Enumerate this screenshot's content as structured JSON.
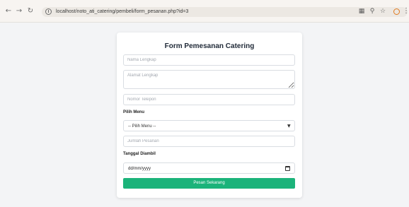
{
  "browser": {
    "url": "localhost/noto_ati_catering/pembeli/form_pesanan.php?id=3",
    "icons": [
      "back-icon",
      "forward-icon",
      "reload-icon",
      "site-info-icon",
      "translate-icon",
      "zoom-icon",
      "bookmark-star-icon",
      "profile-icon",
      "menu-icon"
    ]
  },
  "form": {
    "title": "Form Pemesanan Catering",
    "name_placeholder": "Nama Lengkap",
    "address_placeholder": "Alamat Lengkap",
    "phone_placeholder": "Nomor Telepon",
    "menu_label": "Pilih Menu",
    "menu_selected": "-- Pilih Menu --",
    "quantity_placeholder": "Jumlah Pesanan",
    "date_label": "Tanggal Diambil",
    "date_value": "dd/mm/yyyy",
    "submit_label": "Pesan Sekarang"
  },
  "colors": {
    "accent": "#1bb37a",
    "page_bg": "#f3f4f6",
    "card_bg": "#ffffff"
  }
}
